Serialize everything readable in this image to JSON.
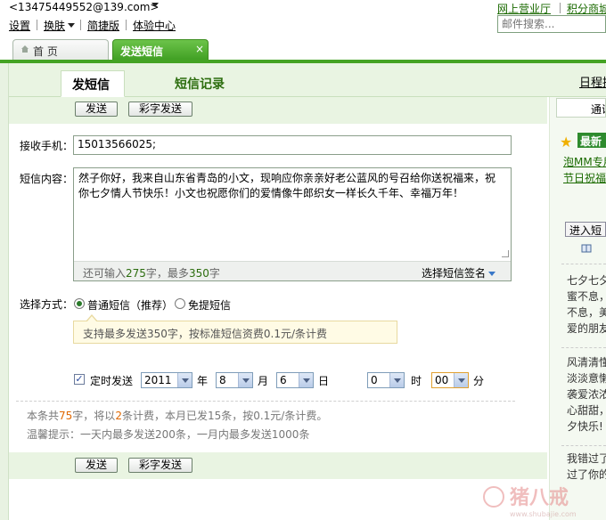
{
  "header": {
    "account": "<13475449552@139.com>",
    "links": [
      "设置",
      "换肤",
      "简捷版",
      "体验中心"
    ],
    "right_links": [
      "网上营业厅",
      "积分商城"
    ],
    "search_placeholder": "邮件搜索..."
  },
  "tabs": {
    "home": "首 页",
    "sms": "发送短信",
    "close": "×"
  },
  "subtabs": {
    "send": "发短信",
    "records": "短信记录",
    "schedule": "日程提"
  },
  "buttons": {
    "send": "发送",
    "color_send": "彩字发送"
  },
  "form": {
    "recipient_label": "接收手机：",
    "recipient_value": "15013566025;",
    "content_label": "短信内容：",
    "content_value": "然子你好，我来自山东省青岛的小文，现响应你亲亲好老公蓝风的号召给你送祝福来，祝你七夕情人节快乐！小文也祝愿你们的爱情像牛郎织女一样长久千年、幸福万年！",
    "counter_prefix": "还可输入",
    "counter_remaining": "275",
    "counter_mid": "字，最多",
    "counter_max": "350",
    "counter_suffix": "字",
    "signature": "选择短信签名",
    "method_label": "选择方式：",
    "method_normal": "普通短信（推荐）",
    "method_free": "免提短信",
    "tip": "支持最多发送350字，按标准短信资费0.1元/条计费",
    "timed_label": "定时发送",
    "year": "2011",
    "year_unit": "年",
    "month": "8",
    "month_unit": "月",
    "day": "6",
    "day_unit": "日",
    "hour": "0",
    "hour_unit": "时",
    "minute": "00",
    "minute_unit": "分"
  },
  "summary": {
    "p1": "本条共",
    "chars": "75",
    "p2": "字，将以",
    "count": "2",
    "p3": "条计费，本月已发15条，按0.1元/条计费。",
    "reminder": "温馨提示：一天内最多发送200条，一月内最多发送1000条"
  },
  "sidebar": {
    "box": "通讯",
    "badge": "最新",
    "links": [
      "泡MM专用",
      "节日祝福"
    ],
    "enter_btn": "进入短",
    "texts1": [
      "七夕七夕",
      "蜜不息，",
      "不息，美",
      "爱的朋友"
    ],
    "texts2": [
      "风清清懂",
      "淡淡意懒",
      "袭爱浓浓",
      "心甜甜，",
      "夕快乐!"
    ],
    "texts3": [
      "我错过了",
      "过了你的"
    ]
  },
  "watermark": {
    "text": "猪八戒",
    "url": "www.shubajie.com"
  },
  "colors": {
    "brand_green": "#44a324",
    "light_green": "#e9f4e2",
    "orange": "#e06800"
  }
}
